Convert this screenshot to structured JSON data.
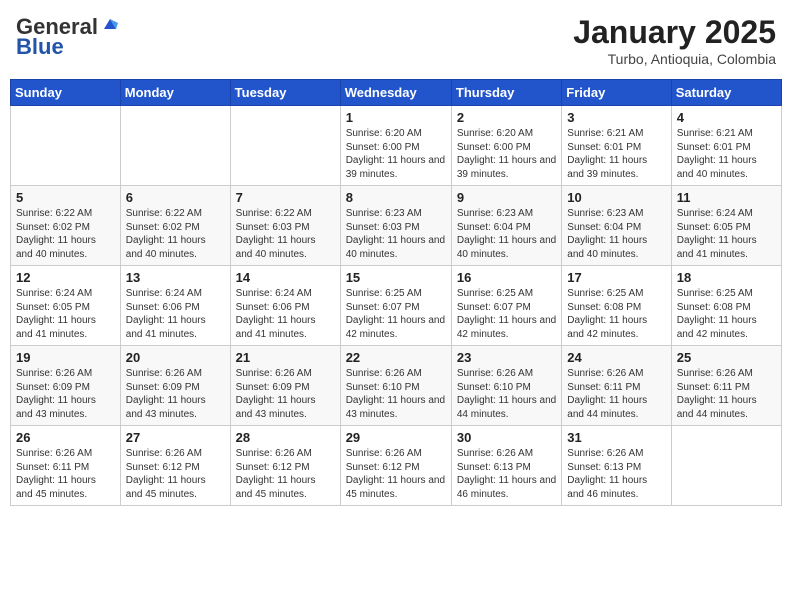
{
  "header": {
    "logo_general": "General",
    "logo_blue": "Blue",
    "month_title": "January 2025",
    "subtitle": "Turbo, Antioquia, Colombia"
  },
  "weekdays": [
    "Sunday",
    "Monday",
    "Tuesday",
    "Wednesday",
    "Thursday",
    "Friday",
    "Saturday"
  ],
  "weeks": [
    [
      {
        "day": "",
        "info": ""
      },
      {
        "day": "",
        "info": ""
      },
      {
        "day": "",
        "info": ""
      },
      {
        "day": "1",
        "info": "Sunrise: 6:20 AM\nSunset: 6:00 PM\nDaylight: 11 hours and 39 minutes."
      },
      {
        "day": "2",
        "info": "Sunrise: 6:20 AM\nSunset: 6:00 PM\nDaylight: 11 hours and 39 minutes."
      },
      {
        "day": "3",
        "info": "Sunrise: 6:21 AM\nSunset: 6:01 PM\nDaylight: 11 hours and 39 minutes."
      },
      {
        "day": "4",
        "info": "Sunrise: 6:21 AM\nSunset: 6:01 PM\nDaylight: 11 hours and 40 minutes."
      }
    ],
    [
      {
        "day": "5",
        "info": "Sunrise: 6:22 AM\nSunset: 6:02 PM\nDaylight: 11 hours and 40 minutes."
      },
      {
        "day": "6",
        "info": "Sunrise: 6:22 AM\nSunset: 6:02 PM\nDaylight: 11 hours and 40 minutes."
      },
      {
        "day": "7",
        "info": "Sunrise: 6:22 AM\nSunset: 6:03 PM\nDaylight: 11 hours and 40 minutes."
      },
      {
        "day": "8",
        "info": "Sunrise: 6:23 AM\nSunset: 6:03 PM\nDaylight: 11 hours and 40 minutes."
      },
      {
        "day": "9",
        "info": "Sunrise: 6:23 AM\nSunset: 6:04 PM\nDaylight: 11 hours and 40 minutes."
      },
      {
        "day": "10",
        "info": "Sunrise: 6:23 AM\nSunset: 6:04 PM\nDaylight: 11 hours and 40 minutes."
      },
      {
        "day": "11",
        "info": "Sunrise: 6:24 AM\nSunset: 6:05 PM\nDaylight: 11 hours and 41 minutes."
      }
    ],
    [
      {
        "day": "12",
        "info": "Sunrise: 6:24 AM\nSunset: 6:05 PM\nDaylight: 11 hours and 41 minutes."
      },
      {
        "day": "13",
        "info": "Sunrise: 6:24 AM\nSunset: 6:06 PM\nDaylight: 11 hours and 41 minutes."
      },
      {
        "day": "14",
        "info": "Sunrise: 6:24 AM\nSunset: 6:06 PM\nDaylight: 11 hours and 41 minutes."
      },
      {
        "day": "15",
        "info": "Sunrise: 6:25 AM\nSunset: 6:07 PM\nDaylight: 11 hours and 42 minutes."
      },
      {
        "day": "16",
        "info": "Sunrise: 6:25 AM\nSunset: 6:07 PM\nDaylight: 11 hours and 42 minutes."
      },
      {
        "day": "17",
        "info": "Sunrise: 6:25 AM\nSunset: 6:08 PM\nDaylight: 11 hours and 42 minutes."
      },
      {
        "day": "18",
        "info": "Sunrise: 6:25 AM\nSunset: 6:08 PM\nDaylight: 11 hours and 42 minutes."
      }
    ],
    [
      {
        "day": "19",
        "info": "Sunrise: 6:26 AM\nSunset: 6:09 PM\nDaylight: 11 hours and 43 minutes."
      },
      {
        "day": "20",
        "info": "Sunrise: 6:26 AM\nSunset: 6:09 PM\nDaylight: 11 hours and 43 minutes."
      },
      {
        "day": "21",
        "info": "Sunrise: 6:26 AM\nSunset: 6:09 PM\nDaylight: 11 hours and 43 minutes."
      },
      {
        "day": "22",
        "info": "Sunrise: 6:26 AM\nSunset: 6:10 PM\nDaylight: 11 hours and 43 minutes."
      },
      {
        "day": "23",
        "info": "Sunrise: 6:26 AM\nSunset: 6:10 PM\nDaylight: 11 hours and 44 minutes."
      },
      {
        "day": "24",
        "info": "Sunrise: 6:26 AM\nSunset: 6:11 PM\nDaylight: 11 hours and 44 minutes."
      },
      {
        "day": "25",
        "info": "Sunrise: 6:26 AM\nSunset: 6:11 PM\nDaylight: 11 hours and 44 minutes."
      }
    ],
    [
      {
        "day": "26",
        "info": "Sunrise: 6:26 AM\nSunset: 6:11 PM\nDaylight: 11 hours and 45 minutes."
      },
      {
        "day": "27",
        "info": "Sunrise: 6:26 AM\nSunset: 6:12 PM\nDaylight: 11 hours and 45 minutes."
      },
      {
        "day": "28",
        "info": "Sunrise: 6:26 AM\nSunset: 6:12 PM\nDaylight: 11 hours and 45 minutes."
      },
      {
        "day": "29",
        "info": "Sunrise: 6:26 AM\nSunset: 6:12 PM\nDaylight: 11 hours and 45 minutes."
      },
      {
        "day": "30",
        "info": "Sunrise: 6:26 AM\nSunset: 6:13 PM\nDaylight: 11 hours and 46 minutes."
      },
      {
        "day": "31",
        "info": "Sunrise: 6:26 AM\nSunset: 6:13 PM\nDaylight: 11 hours and 46 minutes."
      },
      {
        "day": "",
        "info": ""
      }
    ]
  ]
}
